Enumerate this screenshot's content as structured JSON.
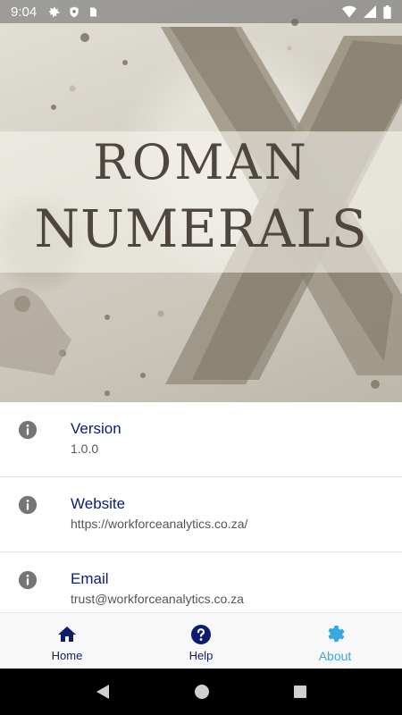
{
  "status_bar": {
    "time": "9:04",
    "left_icons": [
      "gear-icon",
      "shield-icon",
      "sd-card-icon"
    ],
    "right_icons": [
      "wifi-icon",
      "signal-icon",
      "battery-icon"
    ]
  },
  "hero": {
    "title_line1": "ROMAN",
    "title_line2": "NUMERALS"
  },
  "info_items": [
    {
      "icon": "info-icon",
      "title": "Version",
      "value": "1.0.0"
    },
    {
      "icon": "info-icon",
      "title": "Website",
      "value": "https://workforceanalytics.co.za/"
    },
    {
      "icon": "info-icon",
      "title": "Email",
      "value": "trust@workforceanalytics.co.za"
    }
  ],
  "bottom_nav": {
    "items": [
      {
        "icon": "home-icon",
        "label": "Home",
        "active": false
      },
      {
        "icon": "help-icon",
        "label": "Help",
        "active": false
      },
      {
        "icon": "settings-icon",
        "label": "About",
        "active": true
      }
    ]
  },
  "colors": {
    "accent_dark": "#0d1c6e",
    "accent_active": "#3ba7e0"
  }
}
